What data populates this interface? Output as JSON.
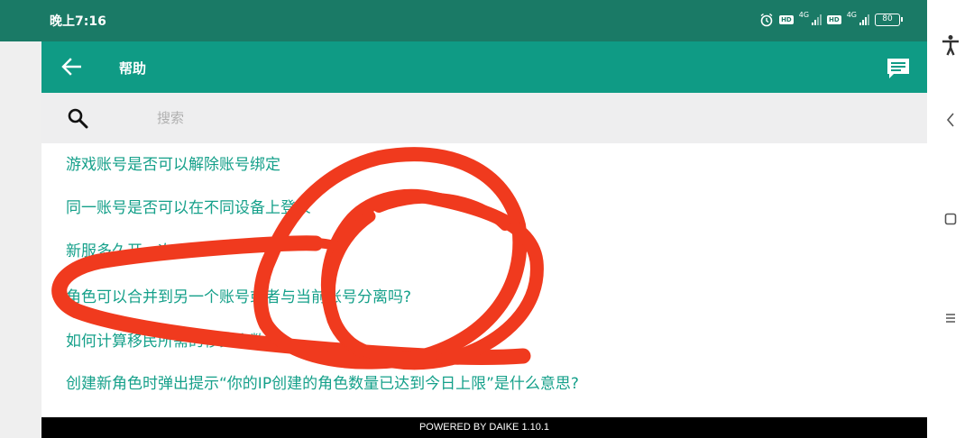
{
  "status_bar": {
    "time": "晚上7:16",
    "network_1": "4G",
    "network_2": "4G",
    "battery": "80",
    "icons": [
      "alarm-icon",
      "hd-icon",
      "signal-icon",
      "hd-icon",
      "signal-icon",
      "battery-icon"
    ]
  },
  "app_bar": {
    "title": "帮助",
    "back_icon": "arrow-left-icon",
    "feedback_icon": "message-icon",
    "color": "#0f9b85"
  },
  "search": {
    "placeholder": "搜索",
    "value": "",
    "icon": "search-icon"
  },
  "faq": {
    "items": [
      "游戏账号是否可以解除账号绑定",
      "同一账号是否可以在不同设备上登录",
      "新服多久开一次",
      "角色可以合并到另一个账号或者与当前账号分离吗?",
      "如何计算移民所需的移民令数量?",
      "创建新角色时弹出提示“你的IP创建的角色数量已达到今日上限”是什么意思?"
    ],
    "text_color": "#15a08a"
  },
  "footer": {
    "text": "POWERED BY DAIKE 1.10.1"
  },
  "nav_panel": {
    "icons": [
      "accessibility-icon",
      "back-chevron-icon",
      "home-square-icon",
      "menu-lines-icon"
    ]
  },
  "colors": {
    "status_bar": "#1a7a66",
    "scribble": "#f03a1e"
  }
}
